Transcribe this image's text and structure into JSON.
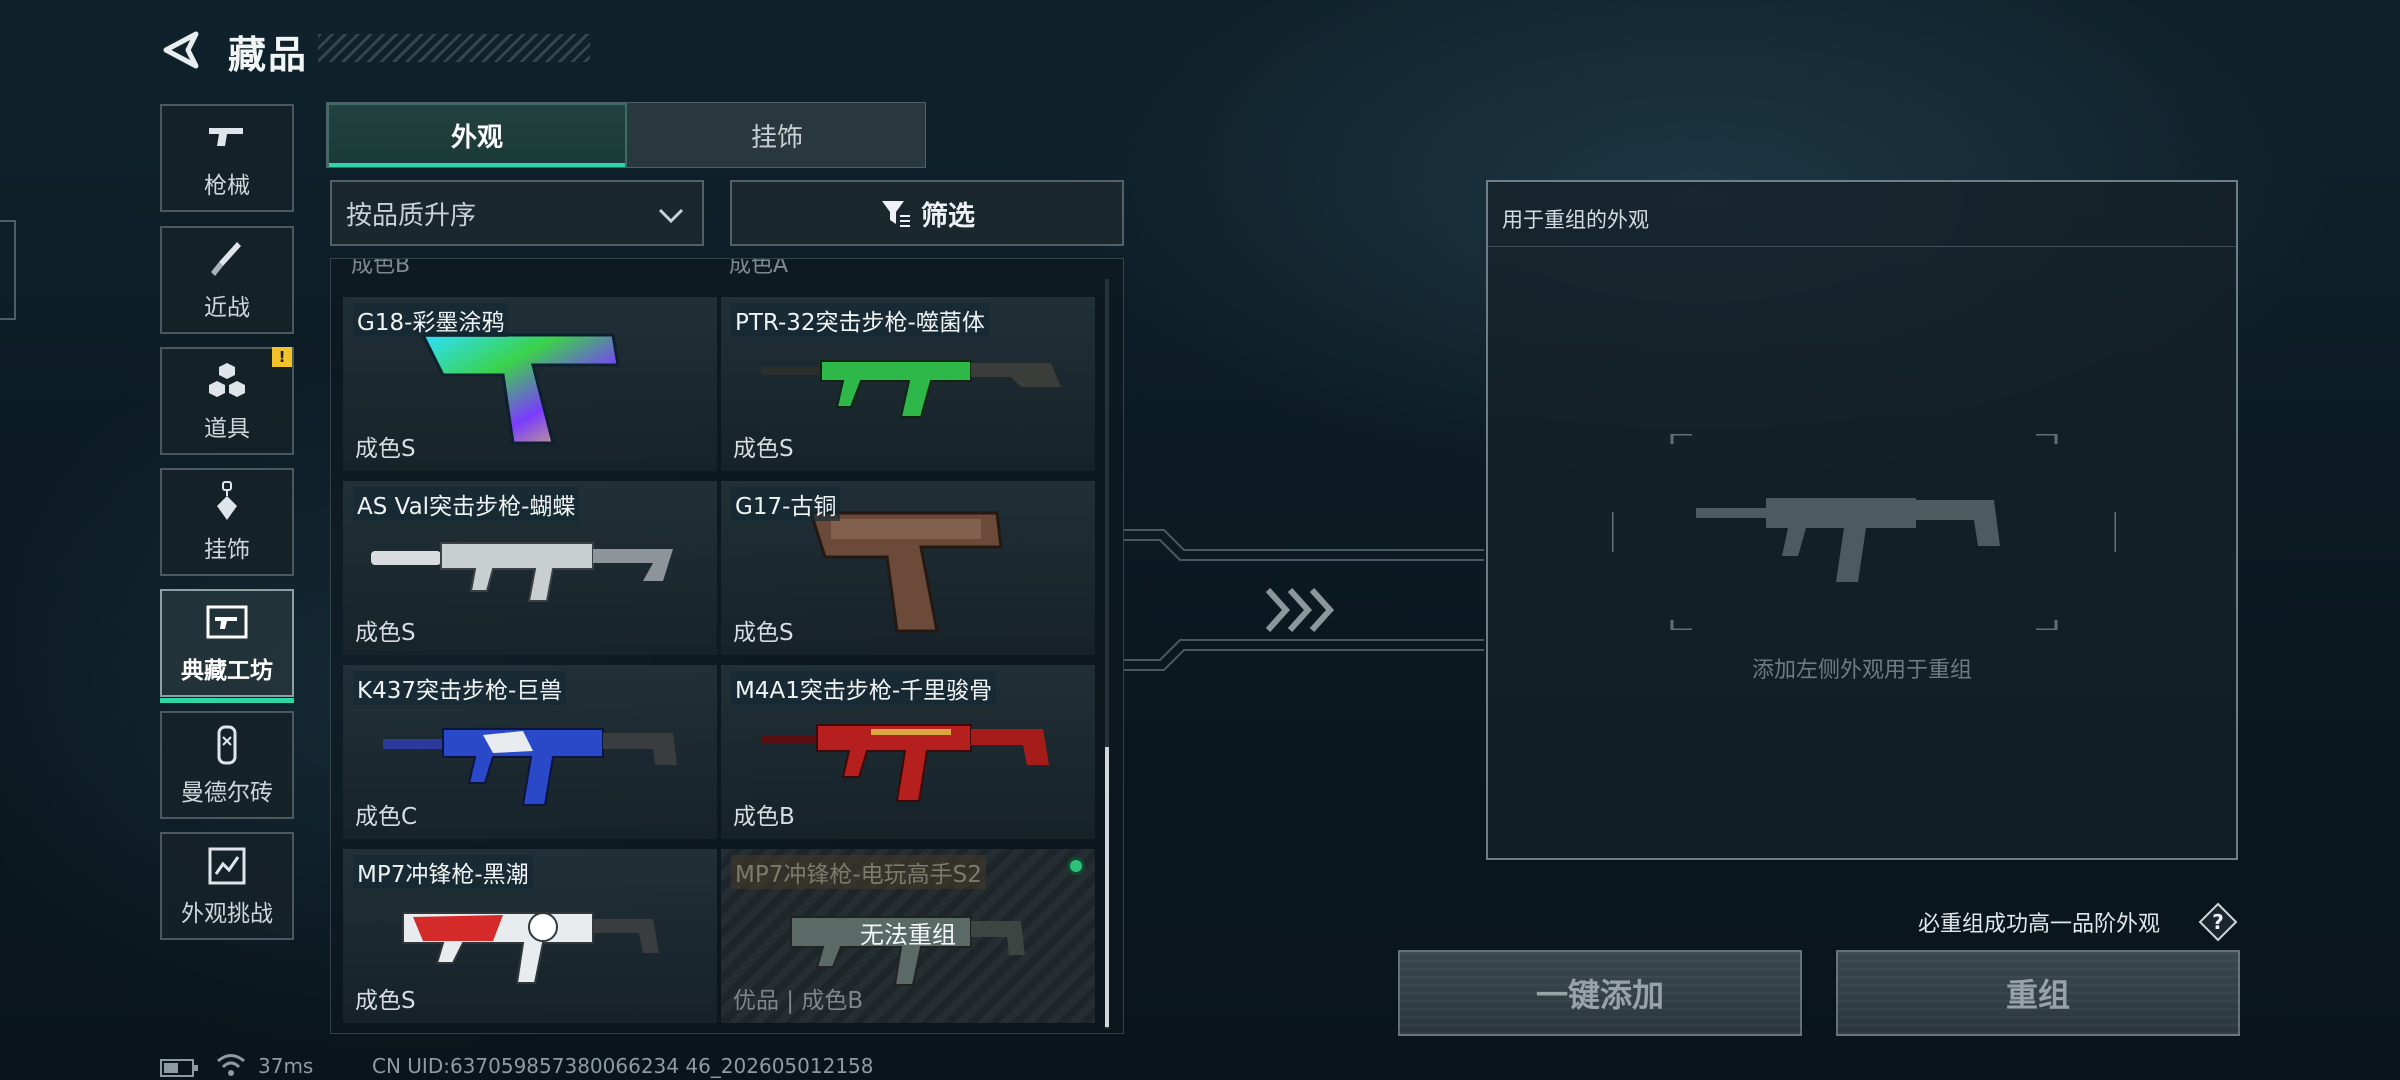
{
  "header": {
    "title": "藏品",
    "back_icon": "back-arrow-icon"
  },
  "sidebar": {
    "items": [
      {
        "label": "枪械",
        "icon": "pistol-icon"
      },
      {
        "label": "近战",
        "icon": "knife-icon"
      },
      {
        "label": "道具",
        "icon": "cubes-icon",
        "badge": "!"
      },
      {
        "label": "挂饰",
        "icon": "charm-icon"
      },
      {
        "label": "典藏工坊",
        "icon": "workshop-icon",
        "active": true
      },
      {
        "label": "曼德尔砖",
        "icon": "brick-icon"
      },
      {
        "label": "外观挑战",
        "icon": "challenge-icon"
      }
    ]
  },
  "tabs": [
    {
      "label": "外观",
      "active": true
    },
    {
      "label": "挂饰",
      "active": false
    }
  ],
  "sort": {
    "value": "按品质升序"
  },
  "filter": {
    "label": "筛选"
  },
  "grid": {
    "partial_row": [
      "成色B",
      "成色A"
    ],
    "items": [
      {
        "name": "G18-彩墨涂鸦",
        "grade": "成色S"
      },
      {
        "name": "PTR-32突击步枪-噬菌体",
        "grade": "成色S"
      },
      {
        "name": "AS Val突击步枪-蝴蝶",
        "grade": "成色S"
      },
      {
        "name": "G17-古铜",
        "grade": "成色S"
      },
      {
        "name": "K437突击步枪-巨兽",
        "grade": "成色C"
      },
      {
        "name": "M4A1突击步枪-千里骏骨",
        "grade": "成色B"
      },
      {
        "name": "MP7冲锋枪-黑潮",
        "grade": "成色S"
      },
      {
        "name": "MP7冲锋枪-电玩高手S2",
        "grade": "优品 | 成色B",
        "blocked_text": "无法重组",
        "disabled": true
      }
    ]
  },
  "recompose": {
    "title": "用于重组的外观",
    "hint": "添加左侧外观用于重组",
    "success_note": "必重组成功高一品阶外观",
    "help_icon_label": "?",
    "add_all_label": "一键添加",
    "recompose_label": "重组"
  },
  "status": {
    "ping": "37ms",
    "uid": "CN UID:637059857380066234 46_202605012158"
  },
  "colors": {
    "accent": "#2fd6a8",
    "warning": "#f2c22b",
    "online": "#2fc07a"
  }
}
